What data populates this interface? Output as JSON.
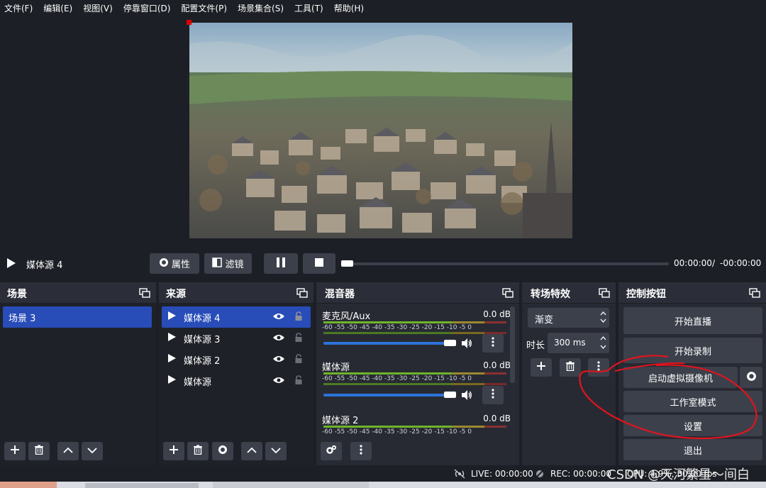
{
  "menu": [
    "文件(F)",
    "编辑(E)",
    "视图(V)",
    "停靠窗口(D)",
    "配置文件(P)",
    "场景集合(S)",
    "工具(T)",
    "帮助(H)"
  ],
  "media_bar": {
    "source_name": "媒体源 4",
    "properties_label": "属性",
    "filters_label": "滤镜",
    "time_current": "00:00:00",
    "time_separator": "/",
    "time_remaining": "-00:00:00",
    "progress": 0
  },
  "scenes": {
    "title": "场景",
    "items": [
      "场景 3"
    ],
    "selected": 0
  },
  "sources": {
    "title": "来源",
    "items": [
      "媒体源 4",
      "媒体源 3",
      "媒体源 2",
      "媒体源"
    ],
    "selected": 0
  },
  "mixer": {
    "title": "混音器",
    "scale": [
      "-60",
      "-55",
      "-50",
      "-45",
      "-40",
      "-35",
      "-30",
      "-25",
      "-20",
      "-15",
      "-10",
      "-5",
      "0"
    ],
    "channels": [
      {
        "name": "麦克风/Aux",
        "db": "0.0 dB",
        "volume": 1.0
      },
      {
        "name": "媒体源",
        "db": "0.0 dB",
        "volume": 1.0
      },
      {
        "name": "媒体源 2",
        "db": "0.0 dB",
        "volume": 1.0
      }
    ]
  },
  "transitions": {
    "title": "转场特效",
    "selected": "渐变",
    "duration_label": "时长",
    "duration_value": "300 ms"
  },
  "controls": {
    "title": "控制按钮",
    "start_stream": "开始直播",
    "start_record": "开始录制",
    "virtual_camera": "启动虚拟摄像机",
    "studio_mode": "工作室模式",
    "settings": "设置",
    "exit": "退出"
  },
  "status": {
    "live": "LIVE: 00:00:00",
    "rec": "REC: 00:00:00",
    "cpu": "CPU: 4.9%, 30.00 fps"
  },
  "watermark": "CSDN @天河繁星～间白",
  "colors": {
    "accent": "#284cb8",
    "annotation": "#e0141e",
    "panel": "#272a33",
    "button": "#3c404b"
  }
}
